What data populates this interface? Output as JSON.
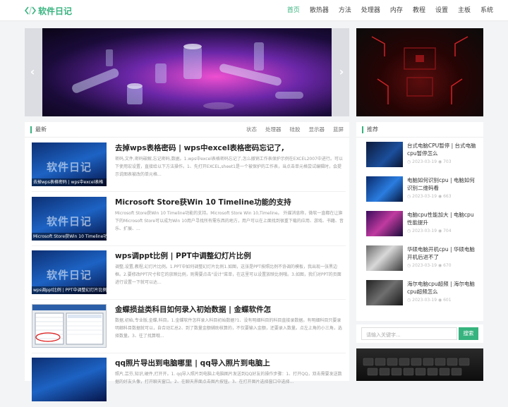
{
  "site": {
    "name": "软件日记",
    "accent": "#36b37e"
  },
  "nav": [
    "首页",
    "散热器",
    "方法",
    "处理器",
    "内存",
    "教程",
    "设置",
    "主板",
    "系统"
  ],
  "latest": {
    "heading": "最新",
    "tags": [
      "状态",
      "处理器",
      "硅胶",
      "显示器",
      "蓝屏"
    ],
    "posts": [
      {
        "title": "去掉wps表格密码 | wps中excel表格密码忘记了,",
        "excerpt": "密码,文件,密码破解,忘记密码,数据。1.wps中excel表格密码忘记了,怎么撤销工作表保护示例在EXCEL2007中进行。可以下使用宏设置，直接给以下方法操作。1、先打开EXCEL,sheet1是一个被保护的工作表，当点击单元格尝试编辑时，会提示说图表被改的单元格...",
        "watermark": "软件日记",
        "caption": "去掉wps表格密码 | wps中excel表格"
      },
      {
        "title": "Microsoft Store获Win 10 Timeline功能的支持",
        "excerpt": "Microsoft Store获Win 10 Timeline功能的支持。Microsoft Store Win 10,Timeline。    外媒消息称，微软一直都在让旗下的Microsoft Store可以成为Win 10用户寻找所有需东西的地方，用户可以在上面找到很重下载的应用、游戏、书籍、音乐、扩展、...",
        "watermark": "软件日记",
        "caption": "Microsoft Store获Win 10 Timeline功"
      },
      {
        "title": "wps调ppt比例 | PPT中调整幻灯片比例",
        "excerpt": "调整,设置,教程,幻灯片比例。1.PPT中如何调整幻灯片比例1.如图，这张是PPT按照比例不协调的模板，我出现一张黑边框。2.要修改PPT尺寸和它的放映比例，则需要点击\"设计\"菜单，在这里可以设置放映比例哦。3.如图，我们对PPT的页面进行设置一下就可以达...",
        "watermark": "软件日记",
        "caption": "wps调ppt比例 | PPT中调整幻灯片比例"
      },
      {
        "title": "金蝶损益类科目如何录入初始数据 | 金蝶软件怎",
        "excerpt": "数据,初始,专业版,金蝶,科目。1.金蝶软件怎样录入科目初始数据?1、没有明细科目的科目直接录数据。有明细科目只要录明细科目数据就可以，自合动汇总2、到了数量金额辅助核算的，不仅要输入金额，还要录入数量。点左上角的小三角，选择数量。3、往了找算哦...",
        "watermark": "",
        "caption": ""
      },
      {
        "title": "qq照片导出到电脑哪里 | qq导入照片到电脑上",
        "excerpt": "照片,芸芬,知识,硬件,打开开。1. qq导入照片到电脑上电脑图片发送到QQ好友的操作步骤：1、打开QQ，双击需要发送数据的好友头像，打开聊天窗口。2、在聊天界面点击图片按钮。3、在打开图片选择窗口中选择...",
        "watermark": "",
        "caption": ""
      }
    ]
  },
  "recommend": {
    "heading": "推荐",
    "items": [
      {
        "title": "台式电脑CPU暂停 | 台式电脑cpu暂停怎么",
        "date": "2023-03-19",
        "views": "703"
      },
      {
        "title": "电脑如何识别cpu | 电脑如何识别二维码看",
        "date": "2023-03-19",
        "views": "663"
      },
      {
        "title": "电脑cpu性能加大 | 电脑cpu性能提升",
        "date": "2023-03-19",
        "views": "704"
      },
      {
        "title": "华硕电脑开机cpu | 华硕电脑开机后进不了",
        "date": "2023-03-19",
        "views": "670"
      },
      {
        "title": "海尔电脑cpu超频 | 海尔电脑cpu超频怎么",
        "date": "2023-03-19",
        "views": "601"
      }
    ]
  },
  "search": {
    "placeholder": "请输入关键字...",
    "button": "搜索"
  }
}
